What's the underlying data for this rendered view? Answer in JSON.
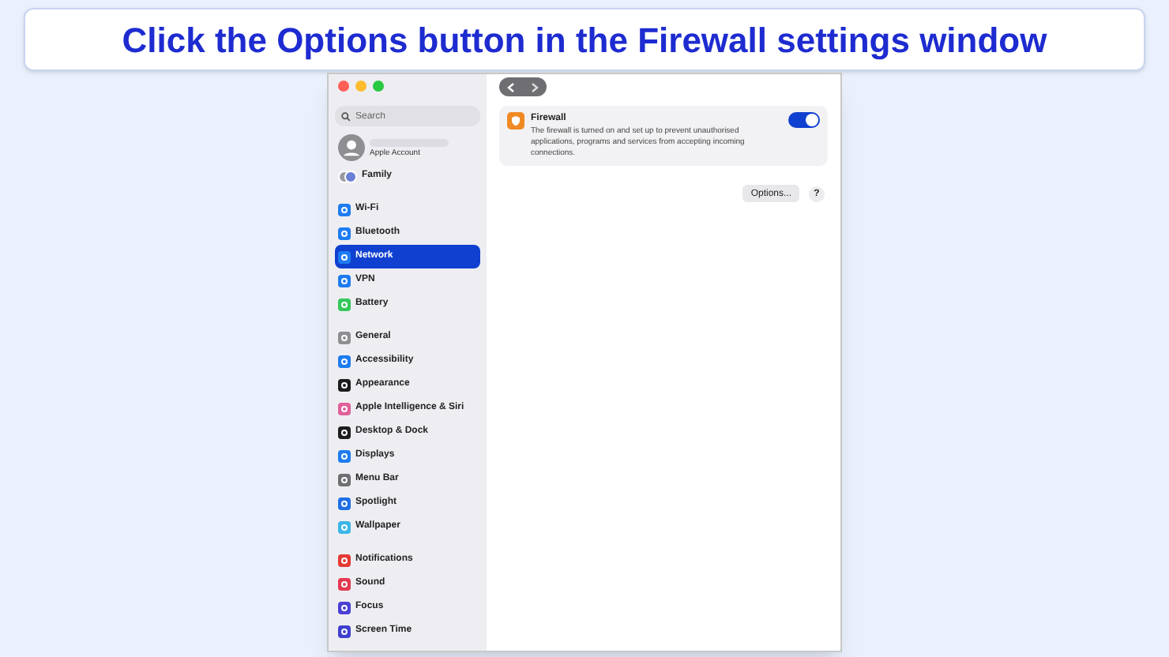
{
  "banner": {
    "text": "Click the Options button in the Firewall settings window"
  },
  "sidebar": {
    "search": {
      "placeholder": "Search"
    },
    "account": {
      "subtitle": "Apple Account"
    },
    "groups": [
      [
        {
          "label": "Family",
          "kind": "family",
          "selected": false
        }
      ],
      [
        {
          "label": "Wi-Fi",
          "kind": "item",
          "color": "#1e7cf2",
          "selected": false
        },
        {
          "label": "Bluetooth",
          "kind": "item",
          "color": "#1e7cf2",
          "selected": false
        },
        {
          "label": "Network",
          "kind": "item",
          "color": "#1e7cf2",
          "selected": true
        },
        {
          "label": "VPN",
          "kind": "item",
          "color": "#1e7cf2",
          "selected": false
        },
        {
          "label": "Battery",
          "kind": "item",
          "color": "#34c759",
          "selected": false
        }
      ],
      [
        {
          "label": "General",
          "kind": "item",
          "color": "#8e8e93",
          "selected": false
        },
        {
          "label": "Accessibility",
          "kind": "item",
          "color": "#1e7cf2",
          "selected": false
        },
        {
          "label": "Appearance",
          "kind": "item",
          "color": "#1c1c1e",
          "selected": false
        },
        {
          "label": "Apple Intelligence & Siri",
          "kind": "item",
          "color": "#e0609a",
          "selected": false
        },
        {
          "label": "Desktop & Dock",
          "kind": "item",
          "color": "#1c1c1e",
          "selected": false
        },
        {
          "label": "Displays",
          "kind": "item",
          "color": "#1e7cf2",
          "selected": false
        },
        {
          "label": "Menu Bar",
          "kind": "item",
          "color": "#6e6e73",
          "selected": false
        },
        {
          "label": "Spotlight",
          "kind": "item",
          "color": "#1e6ee8",
          "selected": false
        },
        {
          "label": "Wallpaper",
          "kind": "item",
          "color": "#3bb6e8",
          "selected": false
        }
      ],
      [
        {
          "label": "Notifications",
          "kind": "item",
          "color": "#e53935",
          "selected": false
        },
        {
          "label": "Sound",
          "kind": "item",
          "color": "#e53950",
          "selected": false
        },
        {
          "label": "Focus",
          "kind": "item",
          "color": "#4b3fd6",
          "selected": false
        },
        {
          "label": "Screen Time",
          "kind": "item",
          "color": "#3f3fd0",
          "selected": false
        }
      ]
    ]
  },
  "firewall": {
    "title": "Firewall",
    "description": "The firewall is turned on and set up to prevent unauthorised applications, programs and services from accepting incoming connections.",
    "on": true
  },
  "buttons": {
    "options": "Options...",
    "help": "?"
  }
}
